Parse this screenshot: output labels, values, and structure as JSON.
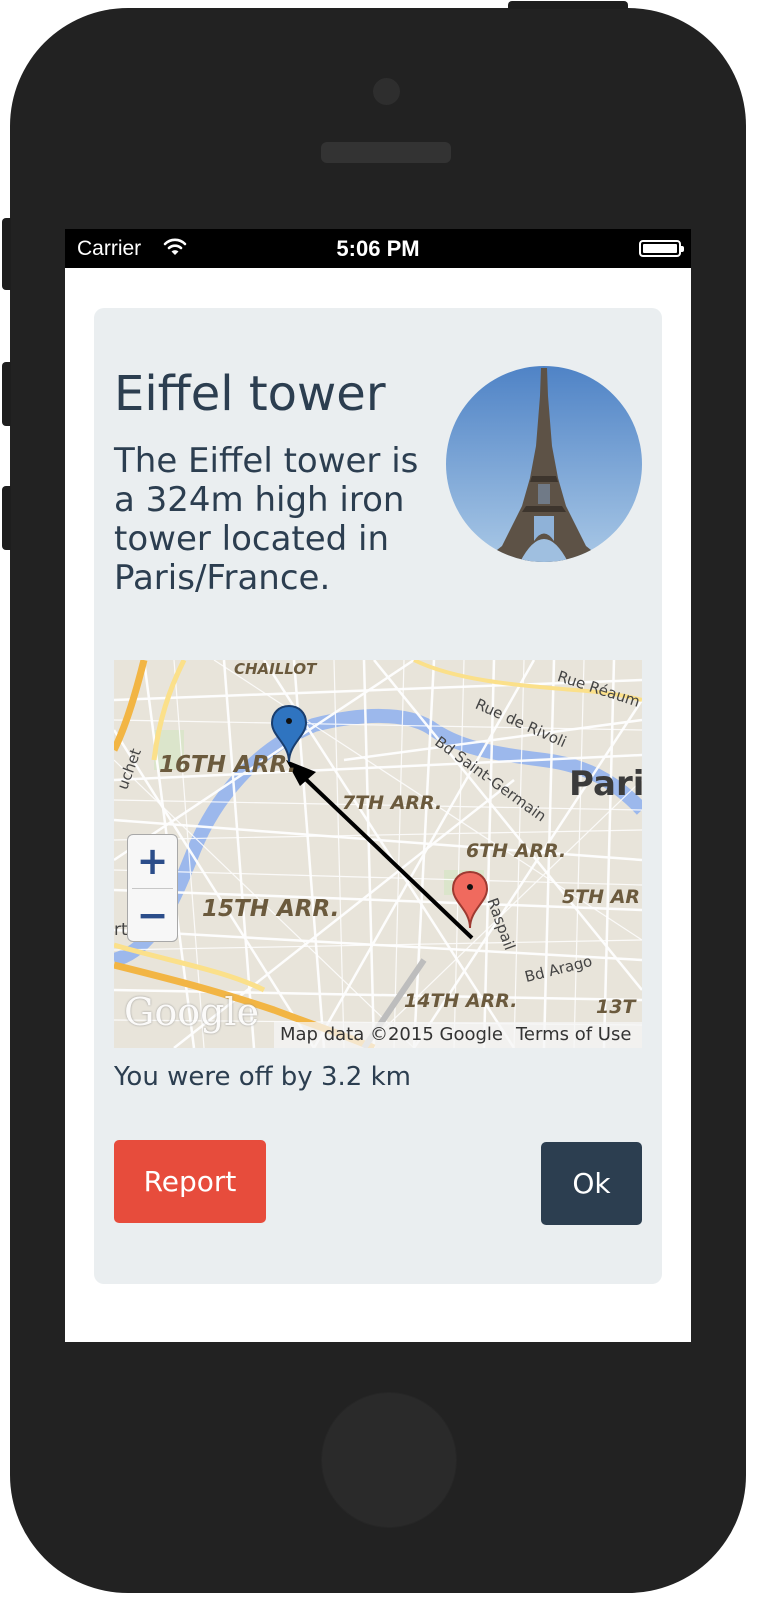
{
  "status_bar": {
    "carrier": "Carrier",
    "time": "5:06 PM",
    "icons": [
      "wifi-icon",
      "battery-icon"
    ]
  },
  "card": {
    "title": "Eiffel tower",
    "description": "The Eiffel tower is a 324m high iron tower located in Paris/France.",
    "photo": "eiffel-tower-photo"
  },
  "map": {
    "labels": {
      "chaillot": "CHAILLOT",
      "arr16": "16TH ARR.",
      "arr7": "7TH ARR.",
      "arr6": "6TH ARR.",
      "arr15": "15TH ARR.",
      "arr5": "5TH AR",
      "arr14": "14TH ARR.",
      "arr13": "13T",
      "paris": "Pari",
      "rue_reaumur": "Rue Réaum",
      "rue_rivoli": "Rue de Rivoli",
      "bd_saint_germain": "Bd Saint-Germain",
      "raspail": "Raspail",
      "bd_arago": "Bd Arago",
      "suchet": "uchet",
      "rt": "rt"
    },
    "zoom_in": "+",
    "zoom_out": "−",
    "logo": "Google",
    "attribution": "Map data ©2015 Google",
    "terms": "Terms of Use",
    "markers": [
      "correct-location-marker",
      "guess-location-marker"
    ]
  },
  "result_text": "You were off by 3.2 km",
  "buttons": {
    "report": "Report",
    "ok": "Ok"
  },
  "colors": {
    "title_text": "#2c3e50",
    "card_bg": "#eaeef0",
    "report_bg": "#e74c3c",
    "ok_bg": "#2c3e50",
    "correct_marker": "#2f74c0",
    "guess_marker": "#f06a5e"
  }
}
